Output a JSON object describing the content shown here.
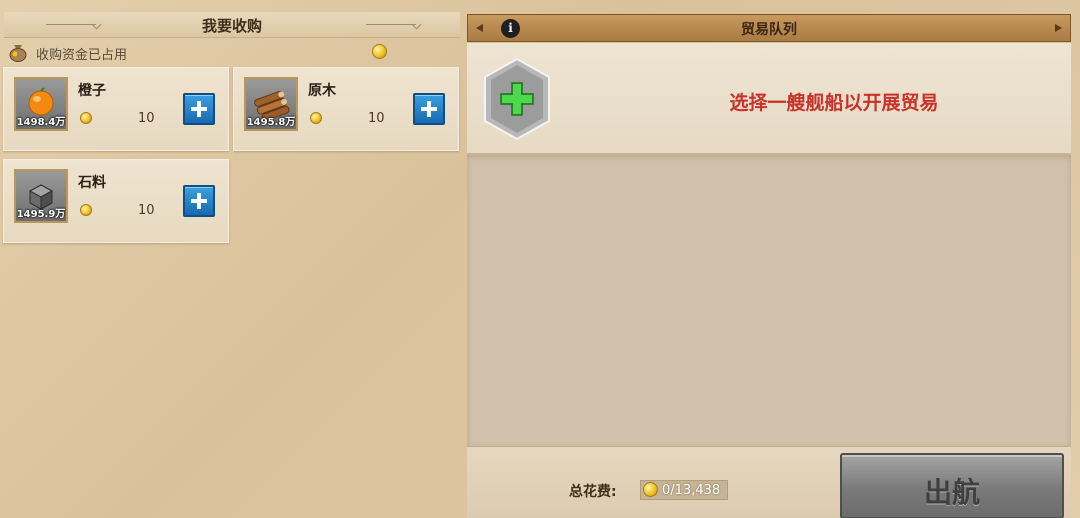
{
  "purchase_panel": {
    "title": "我要收购",
    "funds_label": "收购资金已占用",
    "items": [
      {
        "name": "橙子",
        "quantity": "1498.4万",
        "price": "10",
        "icon": "orange-icon"
      },
      {
        "name": "原木",
        "quantity": "1495.8万",
        "price": "10",
        "icon": "logs-icon"
      },
      {
        "name": "石料",
        "quantity": "1495.9万",
        "price": "10",
        "icon": "stone-icon"
      }
    ]
  },
  "trade_queue": {
    "title": "贸易队列",
    "info_icon": "info-icon",
    "prompt": "选择一艘舰船以开展贸易",
    "total_cost_label": "总花费:",
    "total_cost_value": "0/13,438",
    "sail_button": "出航"
  },
  "colors": {
    "prompt_red": "#c8322a",
    "add_button_blue": "#1869b0",
    "add_ship_green": "#3cc23c",
    "header_brown": "#a97a42"
  }
}
